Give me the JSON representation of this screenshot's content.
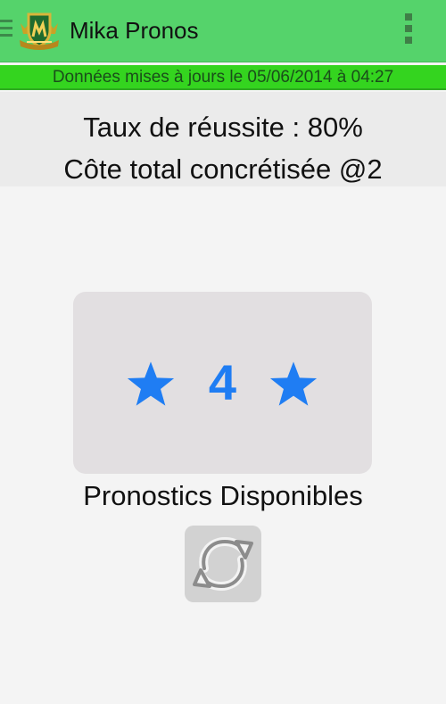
{
  "app": {
    "title": "Mika Pronos",
    "logo_icon": "shield-crest-icon",
    "nav_icon": "menu-icon",
    "overflow_icon": "overflow-menu-icon"
  },
  "update_bar": {
    "text": "Données mises à jours le 05/06/2014 à 04:27"
  },
  "stats": {
    "success_rate": "Taux de réussite : 80%",
    "total_odds": "Côte total concrétisée @2"
  },
  "pronostics": {
    "count": "4",
    "label": "Pronostics Disponibles",
    "star_icon": "star-icon",
    "refresh_icon": "refresh-icon"
  },
  "colors": {
    "appbar": "#55d36b",
    "update_bar": "#34d41f",
    "accent_blue": "#1f7df3",
    "card": "#e2dfe1"
  }
}
